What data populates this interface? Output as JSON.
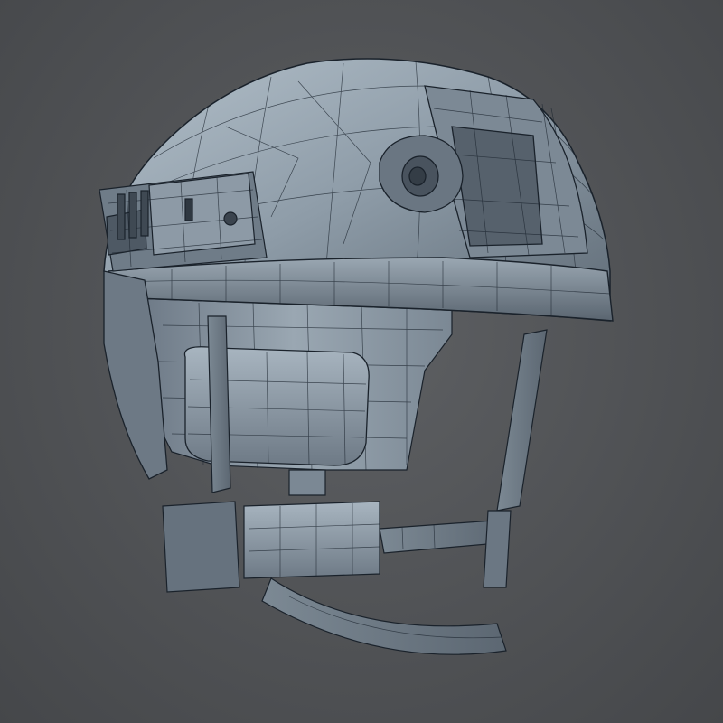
{
  "scene": {
    "subject": "helmet-wireframe-render",
    "colors": {
      "background": "#505255",
      "shell_light": "#a6b3be",
      "shell_mid": "#7f8d99",
      "shell_dark": "#56616c",
      "wire": "#1d2630"
    }
  }
}
